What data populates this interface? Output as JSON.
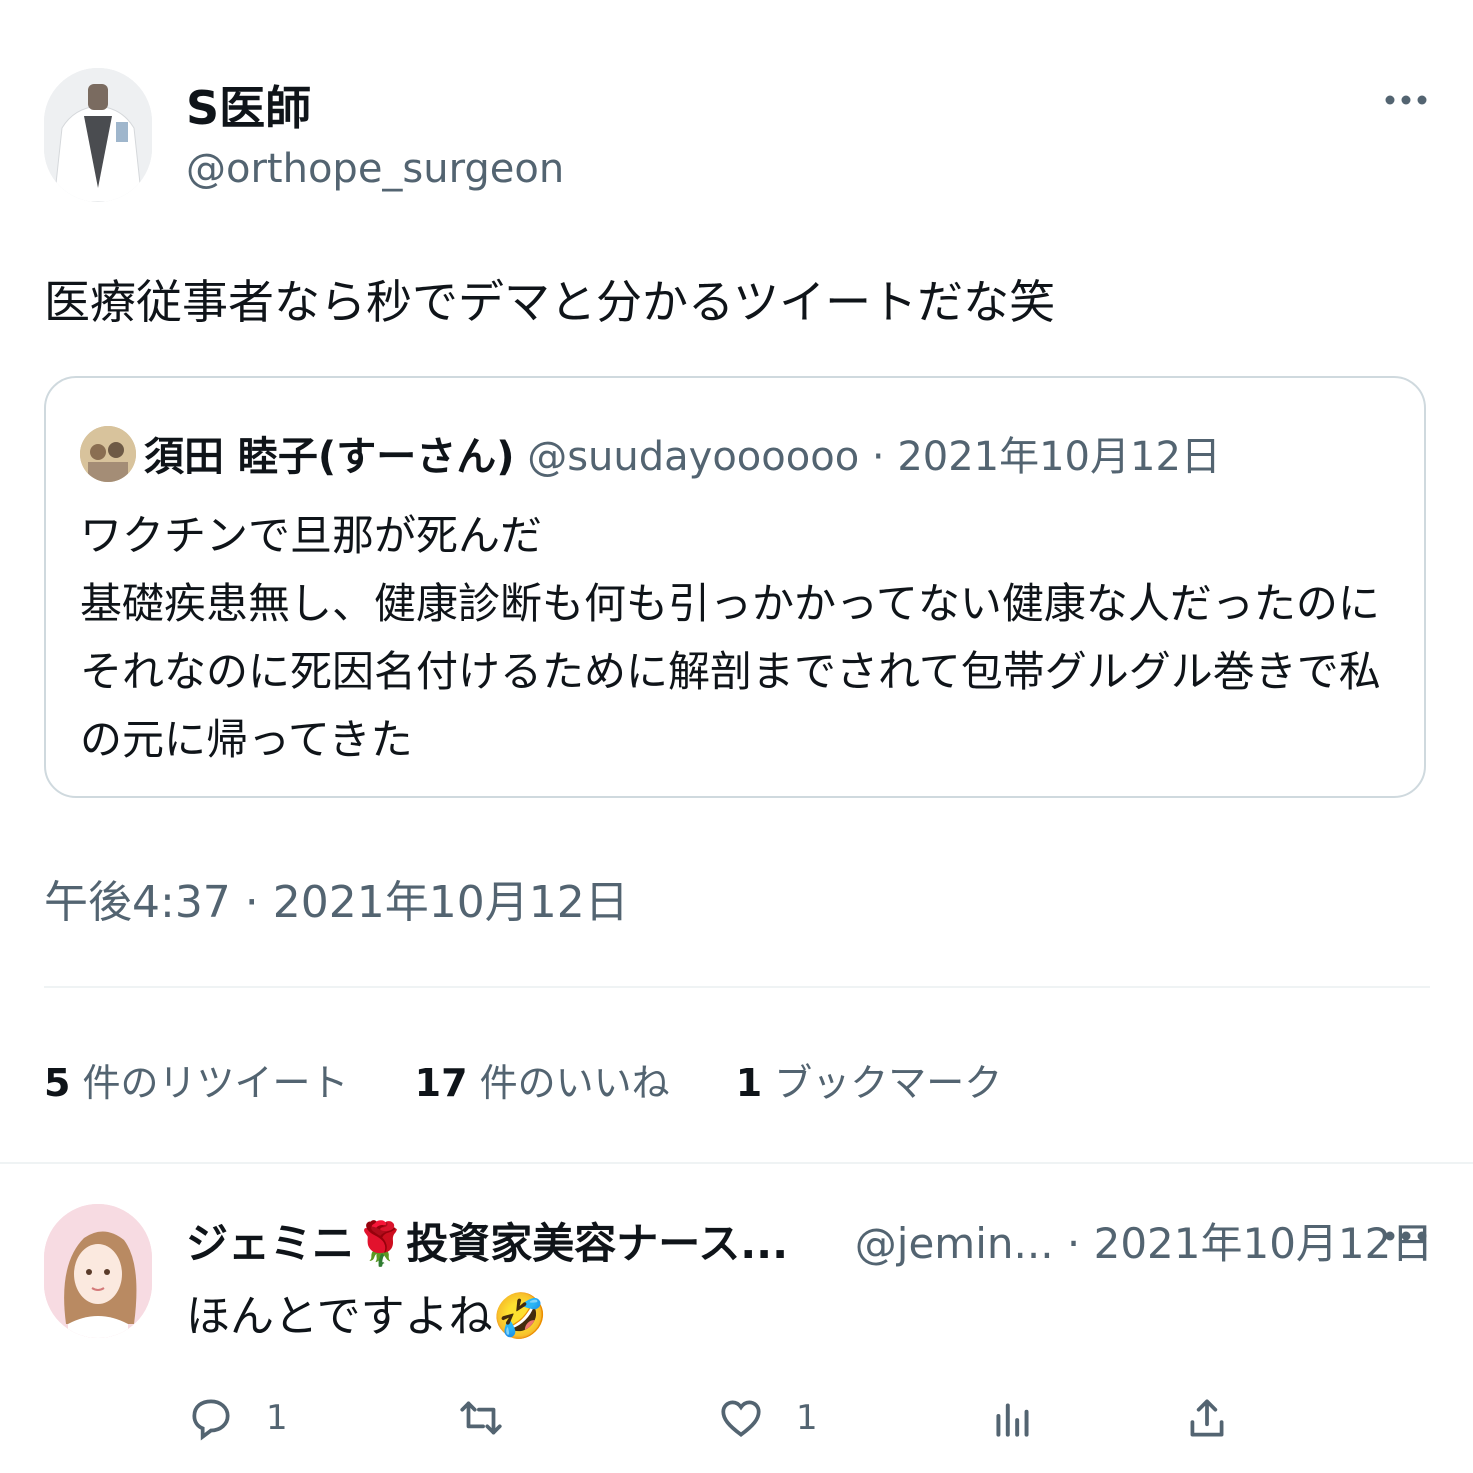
{
  "tweet": {
    "author_name": "S医師",
    "author_handle": "@orthope_surgeon",
    "text": "医療従事者なら秒でデマと分かるツイートだな笑",
    "timestamp": "午後4:37 · 2021年10月12日"
  },
  "quote": {
    "author_name": "須田 睦子(すーさん)",
    "author_meta": " @suudayoooooo · 2021年10月12日",
    "lines": [
      "ワクチンで旦那が死んだ",
      "基礎疾患無し、健康診断も何も引っかかってない健康な人だったのに",
      "それなのに死因名付けるために解剖までされて包帯グルグル巻きで私",
      "の元に帰ってきた"
    ]
  },
  "stats": {
    "retweets_count": "5",
    "retweets_label": " 件のリツイート",
    "likes_count": "17",
    "likes_label": " 件のいいね",
    "bookmarks_count": "1",
    "bookmarks_label": " ブックマーク"
  },
  "reply": {
    "author_name": "ジェミニ🌹投資家美容ナース...",
    "author_meta": "@jemin... · 2021年10月12日",
    "text": "ほんとですよね🤣",
    "actions": {
      "reply_count": "1",
      "like_count": "1"
    }
  },
  "icons": {
    "more": "more-horizontal-icon",
    "reply": "reply-bubble-icon",
    "retweet": "retweet-icon",
    "like": "heart-icon",
    "views": "bar-chart-icon",
    "share": "share-upload-icon"
  }
}
